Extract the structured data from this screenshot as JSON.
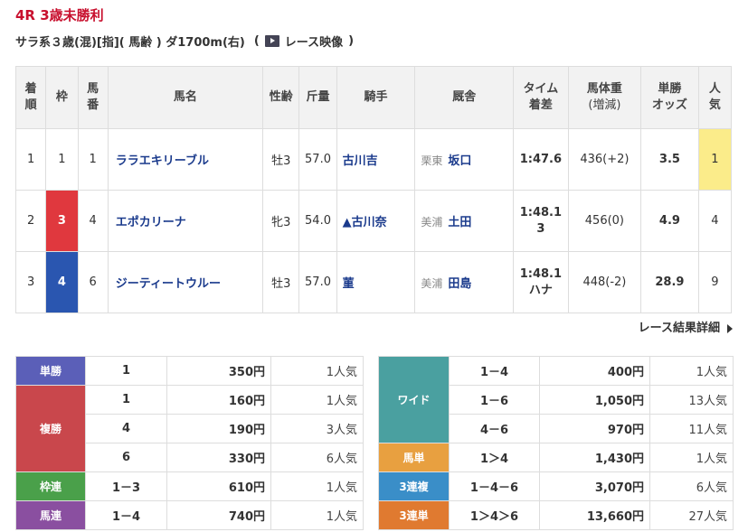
{
  "race": {
    "title": "4R 3歳未勝利",
    "conditions": "サラ系３歳(混)[指]( 馬齢 ) ダ1700m(右)",
    "paren_open": "(",
    "video_label": "レース映像",
    "paren_close": ")"
  },
  "results_header": {
    "rank": [
      "着",
      "順"
    ],
    "waku": "枠",
    "umaban": [
      "馬",
      "番"
    ],
    "name": "馬名",
    "sexage": "性齢",
    "weight": "斤量",
    "jockey": "騎手",
    "stable": "厩舎",
    "time": [
      "タイム",
      "着差"
    ],
    "body": [
      "馬体重",
      "(増減)"
    ],
    "odds": [
      "単勝",
      "オッズ"
    ],
    "popularity": [
      "人",
      "気"
    ]
  },
  "results": [
    {
      "rank": "1",
      "waku": "1",
      "umaban": "1",
      "name": "ララエキリーブル",
      "sexage": "牡3",
      "weight": "57.0",
      "jockey": "古川吉",
      "region": "栗東",
      "trainer": "坂口",
      "time": "1:47.6",
      "margin": "",
      "body": "436(+2)",
      "odds": "3.5",
      "pop": "1",
      "waku_color": "#ffffff"
    },
    {
      "rank": "2",
      "waku": "3",
      "umaban": "4",
      "name": "エポカリーナ",
      "sexage": "牝3",
      "weight": "54.0",
      "jockey": "▲古川奈",
      "region": "美浦",
      "trainer": "土田",
      "time": "1:48.1",
      "margin": "3",
      "body": "456(0)",
      "odds": "4.9",
      "pop": "4",
      "waku_color": "#e0383e"
    },
    {
      "rank": "3",
      "waku": "4",
      "umaban": "6",
      "name": "ジーティートウルー",
      "sexage": "牡3",
      "weight": "57.0",
      "jockey": "菫",
      "region": "美浦",
      "trainer": "田島",
      "time": "1:48.1",
      "margin": "ハナ",
      "body": "448(-2)",
      "odds": "28.9",
      "pop": "9",
      "waku_color": "#2a56b0"
    }
  ],
  "detail_link": "レース結果詳細",
  "payout_left": [
    {
      "label": "単勝",
      "color": "#5b5fb8",
      "rows": [
        {
          "num": "1",
          "yen": "350円",
          "pop": "1人気"
        }
      ]
    },
    {
      "label": "複勝",
      "color": "#c9474c",
      "rows": [
        {
          "num": "1",
          "yen": "160円",
          "pop": "1人気"
        },
        {
          "num": "4",
          "yen": "190円",
          "pop": "3人気"
        },
        {
          "num": "6",
          "yen": "330円",
          "pop": "6人気"
        }
      ]
    },
    {
      "label": "枠連",
      "color": "#4aa04a",
      "rows": [
        {
          "num": "1－3",
          "yen": "610円",
          "pop": "1人気"
        }
      ]
    },
    {
      "label": "馬連",
      "color": "#8a4fa0",
      "rows": [
        {
          "num": "1－4",
          "yen": "740円",
          "pop": "1人気"
        }
      ]
    }
  ],
  "payout_right": [
    {
      "label": "ワイド",
      "color": "#4aa0a0",
      "rows": [
        {
          "num": "1－4",
          "yen": "400円",
          "pop": "1人気"
        },
        {
          "num": "1－6",
          "yen": "1,050円",
          "pop": "13人気"
        },
        {
          "num": "4－6",
          "yen": "970円",
          "pop": "11人気"
        }
      ]
    },
    {
      "label": "馬単",
      "color": "#e8a040",
      "rows": [
        {
          "num": "1＞4",
          "yen": "1,430円",
          "pop": "1人気"
        }
      ]
    },
    {
      "label": "3連複",
      "color": "#3a8ec8",
      "rows": [
        {
          "num": "1－4－6",
          "yen": "3,070円",
          "pop": "6人気"
        }
      ]
    },
    {
      "label": "3連単",
      "color": "#e07a30",
      "rows": [
        {
          "num": "1＞4＞6",
          "yen": "13,660円",
          "pop": "27人気"
        }
      ]
    }
  ]
}
